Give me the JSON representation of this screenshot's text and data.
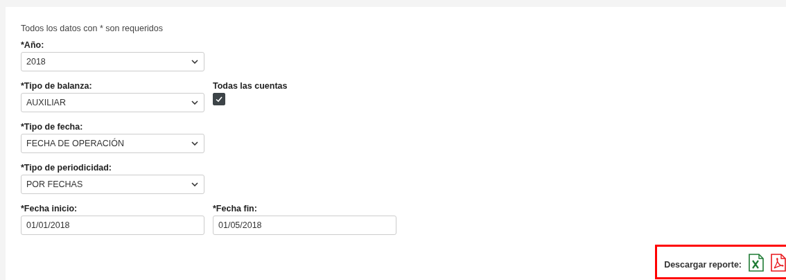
{
  "note": "Todos los datos con * son requeridos",
  "rows": [
    [
      {
        "kind": "select",
        "label": "*Año:",
        "value": "2018"
      }
    ],
    [
      {
        "kind": "select",
        "label": "*Tipo de balanza:",
        "value": "AUXILIAR"
      },
      {
        "kind": "checkbox",
        "label": "Todas las cuentas",
        "checked": true
      }
    ],
    [
      {
        "kind": "select",
        "label": "*Tipo de fecha:",
        "value": "FECHA DE OPERACIÓN"
      }
    ],
    [
      {
        "kind": "select",
        "label": "*Tipo de periodicidad:",
        "value": "POR FECHAS"
      }
    ],
    [
      {
        "kind": "text",
        "label": "*Fecha inicio:",
        "value": "01/01/2018"
      },
      {
        "kind": "text",
        "label": "*Fecha fin:",
        "value": "01/05/2018"
      }
    ]
  ],
  "download": {
    "label": "Descargar reporte:",
    "highlighted": true,
    "formats": [
      {
        "kind": "excel"
      },
      {
        "kind": "pdf"
      }
    ]
  }
}
